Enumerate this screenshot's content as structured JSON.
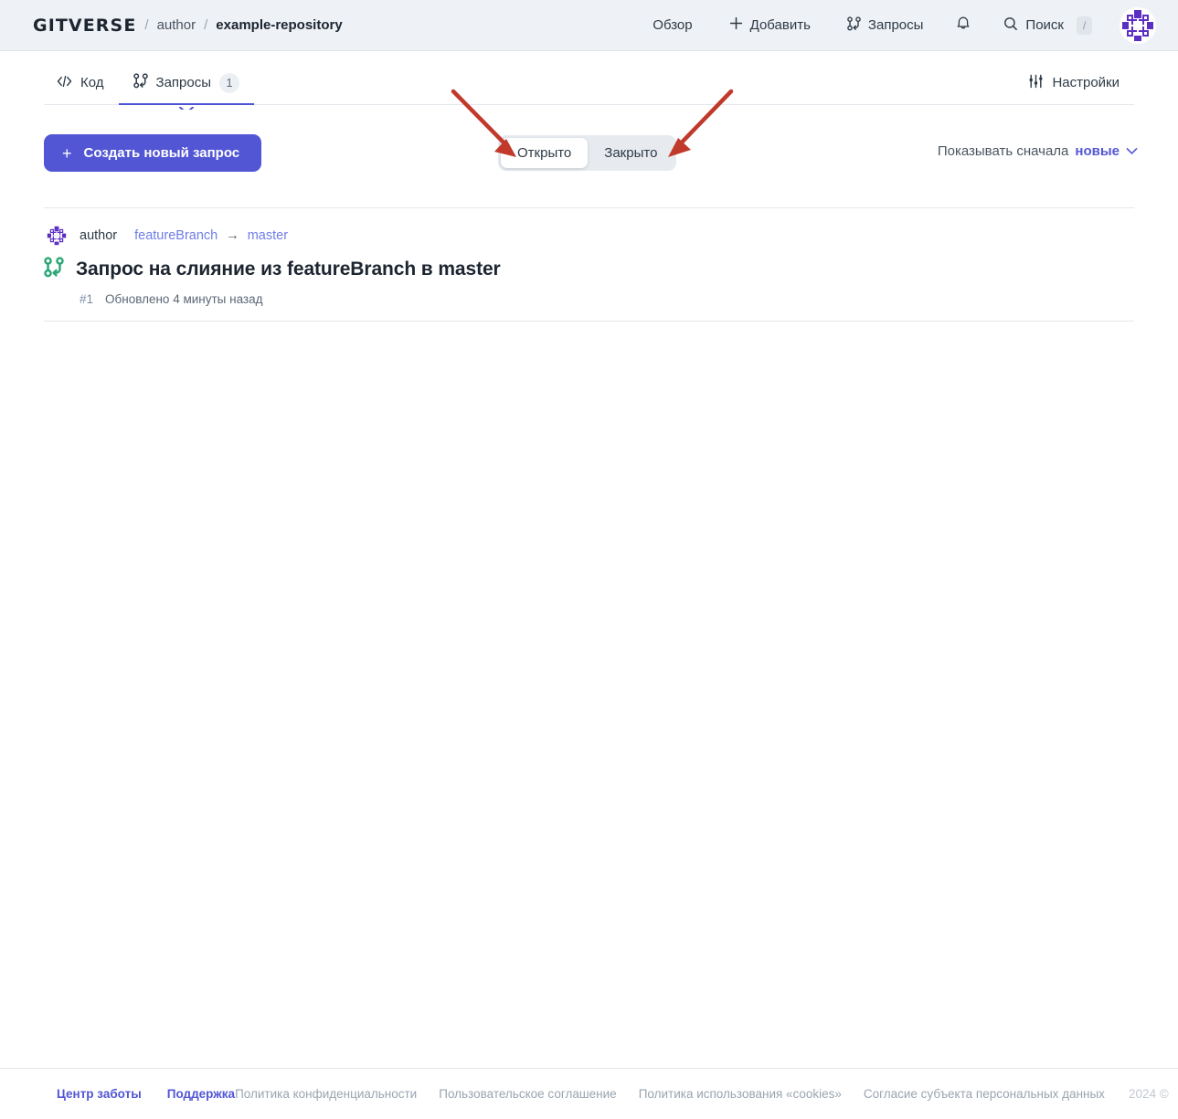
{
  "header": {
    "brand": "GITVERSE",
    "separator": "/",
    "owner": "author",
    "repo": "example-repository",
    "nav": [
      {
        "label": "Обзор",
        "icon": "none"
      },
      {
        "label": "Добавить",
        "icon": "plus-icon"
      },
      {
        "label": "Запросы",
        "icon": "pull-request-icon"
      },
      {
        "label": "",
        "icon": "bell-icon"
      },
      {
        "label": "Поиск",
        "icon": "search-icon",
        "shortcut": "/"
      }
    ],
    "avatar_alt": "user-identicon"
  },
  "repo_tabs": {
    "left": [
      {
        "label": "Код",
        "icon": "code-icon",
        "badge": "",
        "active": false
      },
      {
        "label": "Запросы",
        "icon": "pull-request-icon",
        "badge": "1",
        "active": true
      }
    ],
    "right": {
      "label": "Настройки",
      "icon": "sliders-icon"
    }
  },
  "toolbar": {
    "create_button": "Создать новый запрос",
    "create_button_icon": "plus-icon",
    "filter_segments": [
      {
        "label": "Открыто",
        "active": true
      },
      {
        "label": "Закрыто",
        "active": false
      }
    ],
    "sort": {
      "label": "Показывать сначала",
      "value": "новые",
      "icon": "chevron-down-icon"
    }
  },
  "list": {
    "items": [
      {
        "author": "author",
        "source_branch": "featureBranch",
        "arrow": "→",
        "target_branch": "master",
        "title": "Запрос на слияние из featureBranch в master",
        "number": "#1",
        "updated": "Обновлено 4 минуты назад"
      }
    ]
  },
  "footer": {
    "links": [
      {
        "label": "Центр заботы",
        "style": "accent"
      },
      {
        "label": "Поддержка",
        "style": "accent"
      },
      {
        "label": "Политика конфиденциальности",
        "style": "muted"
      },
      {
        "label": "Пользовательское соглашение",
        "style": "muted"
      },
      {
        "label": "Политика использования «cookies»",
        "style": "muted"
      },
      {
        "label": "Согласие субъекта персональных данных",
        "style": "muted"
      }
    ],
    "copyright": "2024 ©"
  },
  "annotations": {
    "arrow_color": "#c0392b",
    "arrows": [
      {
        "name": "arrow-to-open-tab",
        "target": "Открыто"
      },
      {
        "name": "arrow-to-closed-tab",
        "target": "Закрыто"
      }
    ]
  },
  "colors": {
    "accent": "#5256d4",
    "header_bg": "#eef1f5",
    "link_blue": "#6f7ee8",
    "pr_green": "#2aa775",
    "annotation_red": "#c0392b"
  }
}
